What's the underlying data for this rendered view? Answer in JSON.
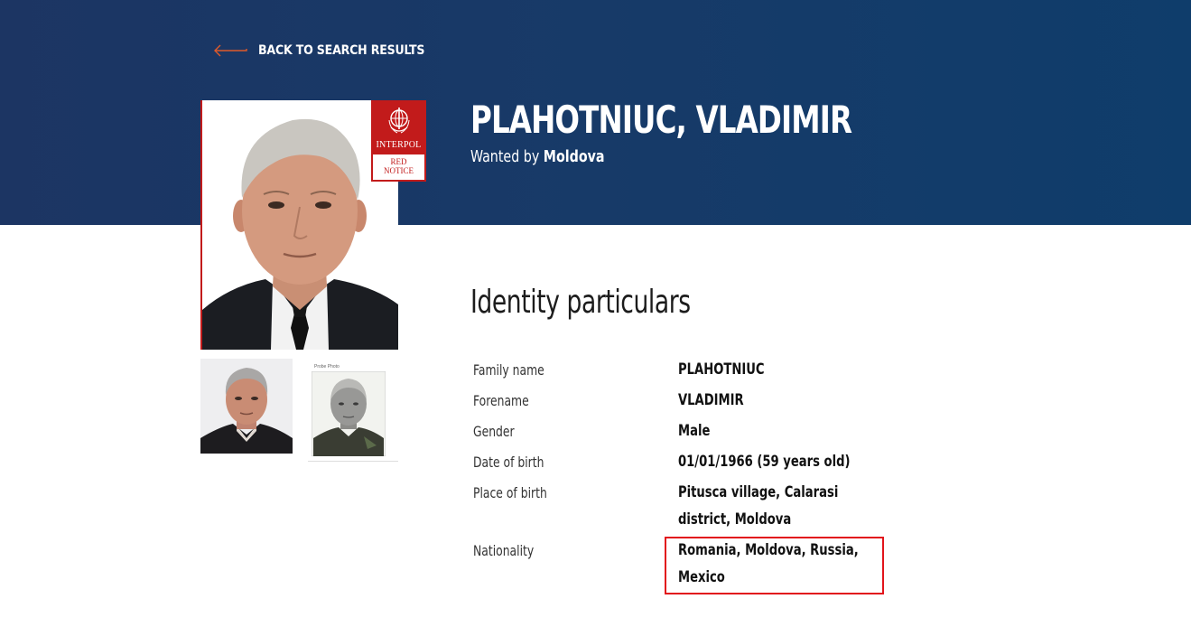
{
  "nav": {
    "back_label": "BACK TO SEARCH RESULTS"
  },
  "notice": {
    "org_label": "INTERPOL",
    "type_line1": "RED",
    "type_line2": "NOTICE",
    "accent_color": "#c21b1b"
  },
  "person": {
    "full_name": "PLAHOTNIUC, VLADIMIR",
    "wanted_prefix": "Wanted by",
    "wanted_country": "Moldova"
  },
  "photos": {
    "thumbnails": [
      {
        "label": ""
      },
      {
        "label": "Probe Photo"
      }
    ]
  },
  "identity": {
    "section_title": "Identity particulars",
    "rows": [
      {
        "label": "Family name",
        "value": "PLAHOTNIUC"
      },
      {
        "label": "Forename",
        "value": "VLADIMIR"
      },
      {
        "label": "Gender",
        "value": "Male"
      },
      {
        "label": "Date of birth",
        "value": "01/01/1966 (59 years old)"
      },
      {
        "label": "Place of birth",
        "value": "Pitusca village, Calarasi district, Moldova"
      },
      {
        "label": "Nationality",
        "value": "Romania, Moldova, Russia, Mexico"
      }
    ]
  },
  "theme": {
    "header_color": "#1c3563",
    "highlight_color": "#e2141b"
  }
}
